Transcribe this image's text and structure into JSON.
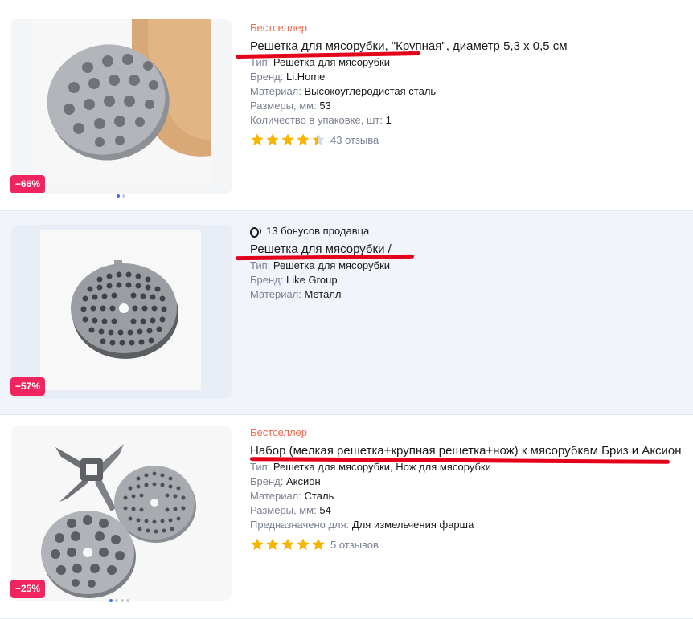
{
  "colors": {
    "discount_bg": "#f0245f",
    "bestseller": "#ef6b4f",
    "star": "#f7b500",
    "annotation_underline": "#e3001b",
    "muted": "#7b8294"
  },
  "products": [
    {
      "tag": "Бестселлер",
      "title": "Решетка для мясорубки, \"Крупная\", диаметр 5,3 х 0,5 см",
      "attributes": [
        {
          "key": "Тип:",
          "value": "Решетка для мясорубки"
        },
        {
          "key": "Бренд:",
          "value": "Li.Home"
        },
        {
          "key": "Материал:",
          "value": "Высокоуглеродистая сталь"
        },
        {
          "key": "Размеры, мм:",
          "value": "53"
        },
        {
          "key": "Количество в упаковке, шт:",
          "value": "1"
        }
      ],
      "rating": 4.5,
      "reviews": "43 отзыва",
      "discount": "−66%",
      "image": "round-mincer-grate-on-wooden-board",
      "carousel_dots": 2
    },
    {
      "bonus": "13 бонусов продавца",
      "bonus_icon": "bonus-coin-icon",
      "title": "Решетка для мясорубки /",
      "attributes": [
        {
          "key": "Тип:",
          "value": "Решетка для мясорубки"
        },
        {
          "key": "Бренд:",
          "value": "Like Group"
        },
        {
          "key": "Материал:",
          "value": "Металл"
        }
      ],
      "discount": "−57%",
      "image": "perforated-mincer-grate"
    },
    {
      "tag": "Бестселлер",
      "title": "Набор (мелкая решетка+крупная решетка+нож) к мясорубкам Бриз и Аксион",
      "attributes": [
        {
          "key": "Тип:",
          "value": "Решетка для мясорубки, Нож для мясорубки"
        },
        {
          "key": "Бренд:",
          "value": "Аксион"
        },
        {
          "key": "Материал:",
          "value": "Сталь"
        },
        {
          "key": "Размеры, мм:",
          "value": "54"
        },
        {
          "key": "Предназначено для:",
          "value": "Для измельчения фарша"
        }
      ],
      "rating": 5,
      "reviews": "5 отзывов",
      "discount": "−25%",
      "image": "mincer-knife-and-two-grates",
      "carousel_dots": 4
    }
  ]
}
